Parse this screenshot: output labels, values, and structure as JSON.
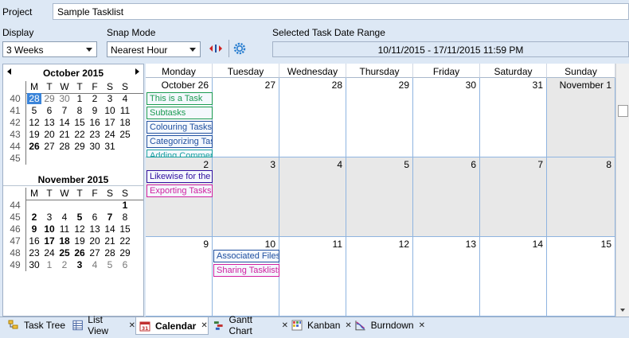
{
  "project": {
    "label": "Project",
    "value": "Sample Tasklist"
  },
  "display": {
    "label": "Display",
    "value": "3 Weeks"
  },
  "snap": {
    "label": "Snap Mode",
    "value": "Nearest Hour"
  },
  "range": {
    "label": "Selected Task Date Range",
    "value": "10/11/2015 - 17/11/2015 11:59 PM"
  },
  "toolbar": {
    "icons": [
      "resize-arrows-icon",
      "gear-icon"
    ]
  },
  "mini_calendars": [
    {
      "title": "October 2015",
      "weekday_labels": [
        "M",
        "T",
        "W",
        "T",
        "F",
        "S",
        "S"
      ],
      "weeks": [
        {
          "wk": "40",
          "days": [
            "28",
            "29",
            "30",
            "1",
            "2",
            "3",
            "4"
          ]
        },
        {
          "wk": "41",
          "days": [
            "5",
            "6",
            "7",
            "8",
            "9",
            "10",
            "11"
          ]
        },
        {
          "wk": "42",
          "days": [
            "12",
            "13",
            "14",
            "15",
            "16",
            "17",
            "18"
          ]
        },
        {
          "wk": "43",
          "days": [
            "19",
            "20",
            "21",
            "22",
            "23",
            "24",
            "25"
          ]
        },
        {
          "wk": "44",
          "days": [
            "26",
            "27",
            "28",
            "29",
            "30",
            "31",
            ""
          ]
        },
        {
          "wk": "45",
          "days": [
            "",
            "",
            "",
            "",
            "",
            "",
            ""
          ]
        }
      ]
    },
    {
      "title": "November 2015",
      "weekday_labels": [
        "M",
        "T",
        "W",
        "T",
        "F",
        "S",
        "S"
      ],
      "weeks": [
        {
          "wk": "44",
          "days": [
            "",
            "",
            "",
            "",
            "",
            "",
            "1"
          ]
        },
        {
          "wk": "45",
          "days": [
            "2",
            "3",
            "4",
            "5",
            "6",
            "7",
            "8"
          ]
        },
        {
          "wk": "46",
          "days": [
            "9",
            "10",
            "11",
            "12",
            "13",
            "14",
            "15"
          ]
        },
        {
          "wk": "47",
          "days": [
            "16",
            "17",
            "18",
            "19",
            "20",
            "21",
            "22"
          ]
        },
        {
          "wk": "48",
          "days": [
            "23",
            "24",
            "25",
            "26",
            "27",
            "28",
            "29"
          ]
        },
        {
          "wk": "49",
          "days": [
            "30",
            "1",
            "2",
            "3",
            "4",
            "5",
            "6"
          ]
        }
      ]
    }
  ],
  "calendar": {
    "weekdays": [
      "Monday",
      "Tuesday",
      "Wednesday",
      "Thursday",
      "Friday",
      "Saturday",
      "Sunday"
    ],
    "weeks": [
      [
        "October 26",
        "27",
        "28",
        "29",
        "30",
        "31",
        "November 1"
      ],
      [
        "2",
        "3",
        "4",
        "5",
        "6",
        "7",
        "8"
      ],
      [
        "9",
        "10",
        "11",
        "12",
        "13",
        "14",
        "15"
      ]
    ],
    "tasks": [
      {
        "name": "This is a Task",
        "color": "#1a9a50"
      },
      {
        "name": "Subtasks",
        "color": "#1a9a50"
      },
      {
        "name": "Colouring Tasks",
        "color": "#2050a0"
      },
      {
        "name": "Categorizing Tas",
        "color": "#2050a0"
      },
      {
        "name": "Adding Comment",
        "color": "#1aa0a0"
      },
      {
        "name": "Likewise for the",
        "color": "#3010a0"
      },
      {
        "name": "Exporting Tasks",
        "color": "#d020a0"
      },
      {
        "name": "Associated Files",
        "color": "#2050a0"
      },
      {
        "name": "Sharing Tasklists",
        "color": "#d020a0"
      }
    ]
  },
  "tabs": [
    {
      "label": "Task Tree"
    },
    {
      "label": "List View"
    },
    {
      "label": "Calendar"
    },
    {
      "label": "Gantt Chart"
    },
    {
      "label": "Kanban"
    },
    {
      "label": "Burndown"
    }
  ]
}
